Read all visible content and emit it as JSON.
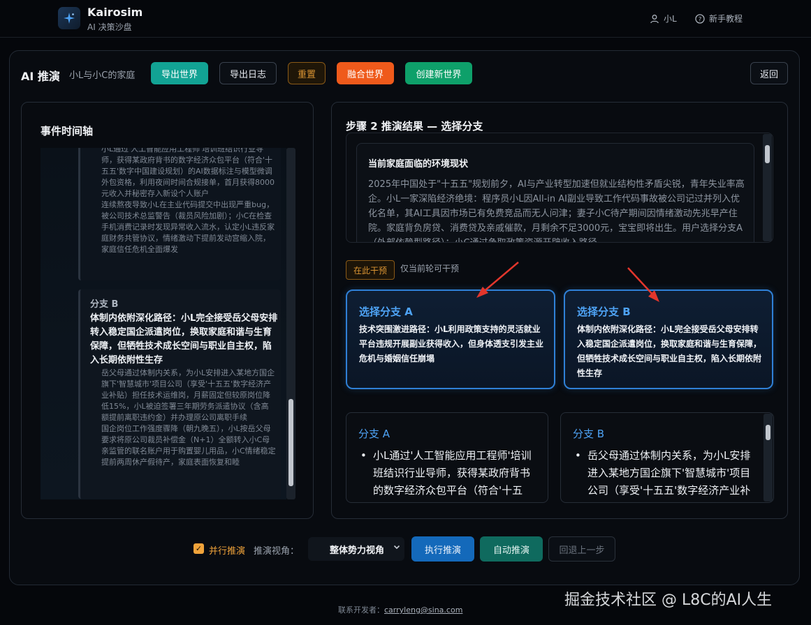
{
  "header": {
    "brand_name": "Kairosim",
    "brand_sub": "AI 决策沙盘",
    "user_label": "小L",
    "help_label": "新手教程"
  },
  "toolbar": {
    "title": "AI 推演",
    "subtitle": "小L与小C的家庭",
    "export_world": "导出世界",
    "export_log": "导出日志",
    "reset": "重置",
    "merge_world": "融合世界",
    "create_world": "创建新世界",
    "back": "返回"
  },
  "timeline": {
    "title": "事件时间轴",
    "block1_text": "小L通过'人工智能应用工程师'培训班结识行业导师，获得某政府背书的数字经济众包平台（符合'十五五'数字中国建设规划）的AI数据标注与模型微调外包资格，利用夜间时间合规接单，首月获得8000元收入并秘密存入新设个人账户\n连续熬夜导致小L在主业代码提交中出现严重bug，被公司技术总监警告（裁员风险加剧）；小C在检查手机消费记录时发现异常收入流水，认定小L违反家庭财务共管协议，情绪激动下提前发动宫缩入院，家庭信任危机全面爆发",
    "branch_b_label": "分支 B",
    "branch_b_title": "体制内依附深化路径：小L完全接受岳父母安排转入稳定国企派遣岗位，换取家庭和谐与生育保障，但牺牲技术成长空间与职业自主权，陷入长期依附性生存",
    "branch_b_desc": "岳父母通过体制内关系，为小L安排进入某地方国企旗下'智慧城市'项目公司（享受'十五五'数字经济产业补贴）担任技术运维岗，月薪固定但较原岗位降低15%，小L被迫签署三年期劳务派遣协议（含高额提前离职违约金）并办理原公司离职手续\n国企岗位工作强度骤降（朝九晚五），小L按岳父母要求将原公司裁员补偿金（N+1）全额转入小C母亲监管的联名账户用于购置婴儿用品，小C情绪稳定提前两周休产假待产，家庭表面恢复和睦"
  },
  "step": {
    "title": "步骤 2 推演结果 — 选择分支",
    "status_heading": "当前家庭面临的环境现状",
    "status_text": "2025年中国处于\"十五五\"规划前夕，AI与产业转型加速但就业结构性矛盾尖锐，青年失业率高企。小L一家深陷经济绝境：程序员小L因All-in AI副业导致工作代码事故被公司记过并列入优化名单，其AI工具因市场已有免费竞品而无人问津；妻子小C待产期间因情绪激动先兆早产住院。家庭背负房贷、消费贷及亲戚催款，月剩余不足3000元，宝宝即将出生。用户选择分支A（外部依赖型路径）：小C通过争取政策资源开辟收入路径。"
  },
  "intervene": {
    "tag": "在此干预",
    "note": "仅当前轮可干预"
  },
  "branch_cards": [
    {
      "title": "选择分支 A",
      "desc": "技术突围激进路径：小L利用政策支持的灵活就业平台违规开展副业获得收入，但身体透支引发主业危机与婚姻信任崩塌"
    },
    {
      "title": "选择分支 B",
      "desc": "体制内依附深化路径：小L完全接受岳父母安排转入稳定国企派遣岗位，换取家庭和谐与生育保障，但牺牲技术成长空间与职业自主权，陷入长期依附性生存"
    }
  ],
  "detail_cards": [
    {
      "label": "分支 A",
      "bullet": "•",
      "text": "小L通过'人工智能应用工程师'培训班结识行业导师，获得某政府背书的数字经济众包平台（符合'十五五'数字中国建设规划）的AI数据标注"
    },
    {
      "label": "分支 B",
      "bullet": "•",
      "text": "岳父母通过体制内关系，为小L安排进入某地方国企旗下'智慧城市'项目公司（享受'十五五'数字经济产业补贴）担任技术运维岗"
    }
  ],
  "controls": {
    "parallel_check": "✓",
    "parallel_label": "并行推演",
    "view_label": "推演视角：",
    "view_value": "整体势力视角",
    "run": "执行推演",
    "auto": "自动推演",
    "undo": "回退上一步"
  },
  "footer": {
    "prefix": "联系开发者：",
    "email": "carryleng@sina.com"
  },
  "watermark": "掘金技术社区 @ L8C的AI人生",
  "colors": {
    "accent_blue": "#4ea3f5",
    "teal": "#12a394",
    "orange": "#ef5a1b",
    "green": "#0ea06a",
    "amber": "#d99332",
    "arrow_red": "#e2362c"
  }
}
